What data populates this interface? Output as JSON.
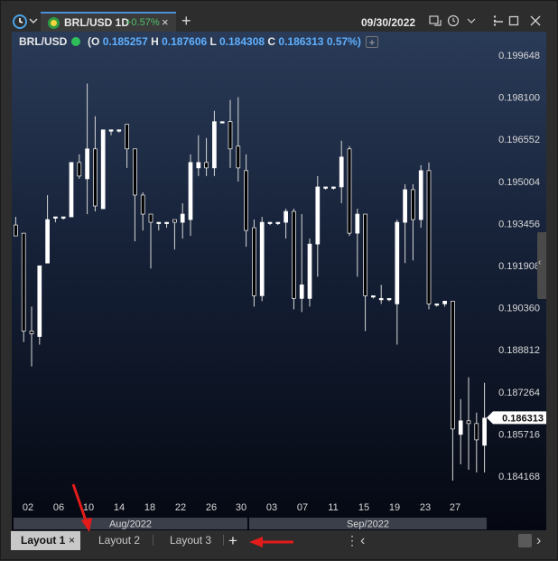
{
  "top": {
    "tab_symbol": "BRL/USD 1D",
    "tab_change": "+0.57%",
    "tab_close": "×",
    "add_tab": "+",
    "date": "09/30/2022",
    "icons": [
      "clock-icon",
      "chevron-down-icon",
      "window-link-icon",
      "history-icon",
      "more-vert-icon",
      "minimize-icon",
      "maximize-icon",
      "close-icon"
    ]
  },
  "chart_header": {
    "symbol": "BRL/USD",
    "open_prefix": "(O",
    "open": "0.185257",
    "high_prefix": "H",
    "high": "0.187606",
    "low_prefix": "L",
    "low": "0.184308",
    "close_prefix": "C",
    "close": "0.186313",
    "change": "0.57%)",
    "add_indicator": "+"
  },
  "chart_data": {
    "type": "candlestick",
    "title": "BRL/USD",
    "y_ticks": [
      "0.199648",
      "0.198100",
      "0.196552",
      "0.195004",
      "0.193456",
      "0.191908",
      "0.190360",
      "0.188812",
      "0.187264",
      "0.185716",
      "0.184168"
    ],
    "x_ticks": [
      "02",
      "06",
      "10",
      "14",
      "18",
      "22",
      "26",
      "30",
      "03",
      "07",
      "11",
      "15",
      "19",
      "23",
      "27"
    ],
    "x_groups": [
      "Aug/2022",
      "Sep/2022"
    ],
    "last_price": "0.186313",
    "candles": [
      {
        "o": 0.1934,
        "h": 0.1937,
        "l": 0.193,
        "c": 0.193
      },
      {
        "o": 0.1931,
        "h": 0.1931,
        "l": 0.1891,
        "c": 0.1895
      },
      {
        "o": 0.1895,
        "h": 0.1904,
        "l": 0.1882,
        "c": 0.1894
      },
      {
        "o": 0.1893,
        "h": 0.1911,
        "l": 0.189,
        "c": 0.1919
      },
      {
        "o": 0.192,
        "h": 0.1945,
        "l": 0.192,
        "c": 0.1936
      },
      {
        "o": 0.1937,
        "h": 0.1937,
        "l": 0.1935,
        "c": 0.1937
      },
      {
        "o": 0.1937,
        "h": 0.1937,
        "l": 0.1936,
        "c": 0.1937
      },
      {
        "o": 0.1937,
        "h": 0.1957,
        "l": 0.1937,
        "c": 0.1957
      },
      {
        "o": 0.1957,
        "h": 0.196,
        "l": 0.1951,
        "c": 0.1952
      },
      {
        "o": 0.1951,
        "h": 0.1986,
        "l": 0.1938,
        "c": 0.1962
      },
      {
        "o": 0.1962,
        "h": 0.1974,
        "l": 0.1939,
        "c": 0.1941
      },
      {
        "o": 0.194,
        "h": 0.1968,
        "l": 0.194,
        "c": 0.1969
      },
      {
        "o": 0.1969,
        "h": 0.1969,
        "l": 0.1967,
        "c": 0.1969
      },
      {
        "o": 0.1969,
        "h": 0.1969,
        "l": 0.1968,
        "c": 0.1969
      },
      {
        "o": 0.1971,
        "h": 0.1971,
        "l": 0.1955,
        "c": 0.1962
      },
      {
        "o": 0.1962,
        "h": 0.1962,
        "l": 0.1928,
        "c": 0.1945
      },
      {
        "o": 0.1945,
        "h": 0.1946,
        "l": 0.1932,
        "c": 0.1938
      },
      {
        "o": 0.1938,
        "h": 0.1938,
        "l": 0.1918,
        "c": 0.1935
      },
      {
        "o": 0.1935,
        "h": 0.1935,
        "l": 0.1932,
        "c": 0.1935
      },
      {
        "o": 0.1935,
        "h": 0.1935,
        "l": 0.1933,
        "c": 0.1935
      },
      {
        "o": 0.1936,
        "h": 0.1936,
        "l": 0.1925,
        "c": 0.1935
      },
      {
        "o": 0.1935,
        "h": 0.1942,
        "l": 0.1929,
        "c": 0.1938
      },
      {
        "o": 0.1936,
        "h": 0.196,
        "l": 0.193,
        "c": 0.1957
      },
      {
        "o": 0.1955,
        "h": 0.1967,
        "l": 0.1952,
        "c": 0.1957
      },
      {
        "o": 0.1957,
        "h": 0.1966,
        "l": 0.1952,
        "c": 0.1955
      },
      {
        "o": 0.1955,
        "h": 0.1976,
        "l": 0.1952,
        "c": 0.1972
      },
      {
        "o": 0.1972,
        "h": 0.1972,
        "l": 0.1972,
        "c": 0.1972
      },
      {
        "o": 0.1972,
        "h": 0.198,
        "l": 0.1955,
        "c": 0.1962
      },
      {
        "o": 0.1963,
        "h": 0.1981,
        "l": 0.195,
        "c": 0.1955
      },
      {
        "o": 0.1954,
        "h": 0.196,
        "l": 0.1926,
        "c": 0.1932
      },
      {
        "o": 0.1933,
        "h": 0.1936,
        "l": 0.1904,
        "c": 0.1908
      },
      {
        "o": 0.1908,
        "h": 0.1937,
        "l": 0.1906,
        "c": 0.1935
      },
      {
        "o": 0.1935,
        "h": 0.1935,
        "l": 0.1934,
        "c": 0.1935
      },
      {
        "o": 0.1935,
        "h": 0.1935,
        "l": 0.1934,
        "c": 0.1935
      },
      {
        "o": 0.1935,
        "h": 0.194,
        "l": 0.1929,
        "c": 0.1939
      },
      {
        "o": 0.1939,
        "h": 0.194,
        "l": 0.1903,
        "c": 0.1907
      },
      {
        "o": 0.1907,
        "h": 0.1938,
        "l": 0.1902,
        "c": 0.1912
      },
      {
        "o": 0.1907,
        "h": 0.1929,
        "l": 0.1904,
        "c": 0.1927
      },
      {
        "o": 0.1927,
        "h": 0.1952,
        "l": 0.1915,
        "c": 0.1948
      },
      {
        "o": 0.1948,
        "h": 0.1948,
        "l": 0.1947,
        "c": 0.1948
      },
      {
        "o": 0.1948,
        "h": 0.1948,
        "l": 0.1947,
        "c": 0.1948
      },
      {
        "o": 0.1948,
        "h": 0.1965,
        "l": 0.1942,
        "c": 0.1959
      },
      {
        "o": 0.1962,
        "h": 0.1963,
        "l": 0.193,
        "c": 0.1931
      },
      {
        "o": 0.1931,
        "h": 0.194,
        "l": 0.1915,
        "c": 0.1938
      },
      {
        "o": 0.1938,
        "h": 0.1938,
        "l": 0.1895,
        "c": 0.1908
      },
      {
        "o": 0.1908,
        "h": 0.1908,
        "l": 0.1907,
        "c": 0.1908
      },
      {
        "o": 0.1907,
        "h": 0.1912,
        "l": 0.1905,
        "c": 0.1907
      },
      {
        "o": 0.1907,
        "h": 0.1907,
        "l": 0.1906,
        "c": 0.1907
      },
      {
        "o": 0.1905,
        "h": 0.1936,
        "l": 0.189,
        "c": 0.1935
      },
      {
        "o": 0.1935,
        "h": 0.1949,
        "l": 0.192,
        "c": 0.1947
      },
      {
        "o": 0.1947,
        "h": 0.1949,
        "l": 0.1921,
        "c": 0.1936
      },
      {
        "o": 0.1936,
        "h": 0.1956,
        "l": 0.1933,
        "c": 0.1954
      },
      {
        "o": 0.1954,
        "h": 0.1957,
        "l": 0.1903,
        "c": 0.1905
      },
      {
        "o": 0.1905,
        "h": 0.1905,
        "l": 0.1904,
        "c": 0.1905
      },
      {
        "o": 0.1905,
        "h": 0.1905,
        "l": 0.1904,
        "c": 0.1906
      },
      {
        "o": 0.1906,
        "h": 0.1906,
        "l": 0.184,
        "c": 0.1859
      },
      {
        "o": 0.1857,
        "h": 0.187,
        "l": 0.1846,
        "c": 0.1862
      },
      {
        "o": 0.1862,
        "h": 0.1878,
        "l": 0.1844,
        "c": 0.1861
      },
      {
        "o": 0.1861,
        "h": 0.1865,
        "l": 0.1843,
        "c": 0.1855
      },
      {
        "o": 0.1853,
        "h": 0.1876,
        "l": 0.1843,
        "c": 0.1863
      }
    ]
  },
  "bottom": {
    "tabs": [
      "Layout 1",
      "Layout 2",
      "Layout 3"
    ],
    "close_label": "×",
    "add_label": "+",
    "more_label": "⋮",
    "left_label": "‹",
    "right_label": "›"
  },
  "colors": {
    "up": "#ffffff",
    "down": "#000000",
    "wick": "#d8d8d8",
    "arrow": "#e31b1b"
  }
}
